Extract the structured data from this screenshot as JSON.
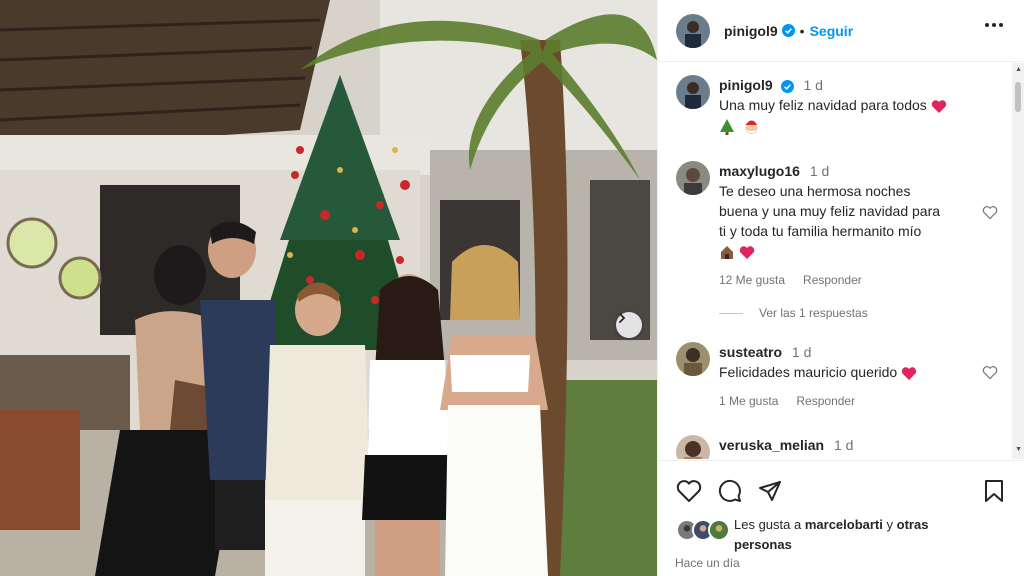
{
  "post": {
    "author": "pinigol9",
    "verified": true,
    "follow_label": "Seguir",
    "time_ago": "Hace un día"
  },
  "photo": {
    "next_icon": "chevron-right-icon"
  },
  "caption": {
    "username": "pinigol9",
    "time": "1 d",
    "text": "Una muy feliz navidad para todos",
    "emojis": [
      "red-heart",
      "christmas-tree",
      "santa"
    ]
  },
  "comments": [
    {
      "username": "maxylugo16",
      "time": "1 d",
      "text_lines": [
        "Te deseo una hermosa noches",
        "buena y una muy feliz navidad para",
        "ti y toda tu familia hermanito mío"
      ],
      "emojis": [
        "house",
        "red-heart"
      ],
      "likes": "12 Me gusta",
      "reply_label": "Responder",
      "view_replies": "Ver las 1 respuestas"
    },
    {
      "username": "susteatro",
      "time": "1 d",
      "text": "Felicidades mauricio querido",
      "emojis": [
        "red-heart"
      ],
      "likes": "1 Me gusta",
      "reply_label": "Responder"
    },
    {
      "username": "veruska_melian",
      "time": "1 d",
      "text": ""
    }
  ],
  "likes_summary": {
    "prefix": "Les gusta a",
    "user": "marcelobarti",
    "suffix_1": "y",
    "suffix_2": "otras",
    "suffix_3": "personas"
  },
  "colors": {
    "accent": "#0095f6",
    "heart": "#ed4956",
    "text": "#262626",
    "muted": "#737373"
  }
}
